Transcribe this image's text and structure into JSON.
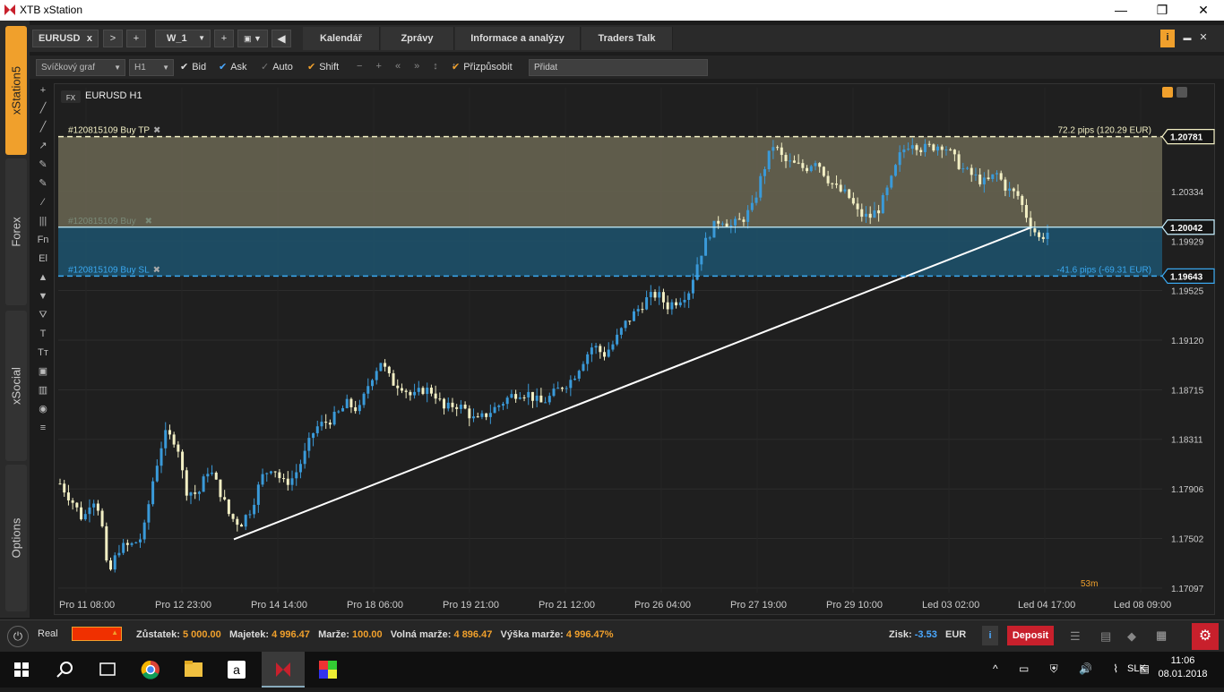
{
  "window": {
    "title": "XTB xStation",
    "min_label": "—",
    "max_label": "❐",
    "close_label": "✕"
  },
  "sidebar": {
    "tabs": [
      {
        "label": "xStation5"
      },
      {
        "label": "Forex"
      },
      {
        "label": "xSocial"
      },
      {
        "label": "Options"
      }
    ]
  },
  "tabbar": {
    "instrument_tab": "EURUSD",
    "close_x": "x",
    "next": ">",
    "add": "+",
    "workspace": "W_1",
    "workspace_add": "+",
    "nav": [
      "Kalendář",
      "Zprávy",
      "Informace a analýzy",
      "Traders Talk"
    ],
    "info_icon": "i",
    "minimize": "▬",
    "close": "✕"
  },
  "toolbar": {
    "chart_type": "Svíčkový graf",
    "interval": "H1",
    "bid": "Bid",
    "ask": "Ask",
    "auto": "Auto",
    "shift": "Shift",
    "fit": "Přizpůsobit",
    "add_placeholder": "Přidat"
  },
  "drawtools": [
    "+",
    "╱",
    "╱",
    "↗",
    "✎",
    "✎",
    "⁄",
    "|||",
    "Fn",
    "El",
    "▲",
    "▼",
    "⛛",
    "T",
    "Tт",
    "▣",
    "▥",
    "◉",
    "≡"
  ],
  "chart": {
    "badge": "FX",
    "title": "EURUSD H1",
    "tp_label": "#120815109 Buy  TP",
    "entry_label": "#120815109 Buy",
    "sl_label": "#120815109 Buy  SL",
    "tp_pips": "72.2 pips (120.29 EUR)",
    "sl_pips": "-41.6 pips (-69.31 EUR)",
    "timer": "53m",
    "colors": {
      "tp_zone": "#6b6754",
      "sl_zone": "#1d4e66",
      "bull": "#3a9ad9",
      "bear": "#f2efc4",
      "trend": "#ffffff"
    }
  },
  "chart_data": {
    "type": "candlestick",
    "symbol": "EURUSD",
    "interval": "H1",
    "y_ticks": [
      "1.17097",
      "1.17502",
      "1.17906",
      "1.18311",
      "1.18715",
      "1.19120",
      "1.19525",
      "1.19929",
      "1.20334"
    ],
    "y_tick_values": [
      1.17097,
      1.17502,
      1.17906,
      1.18311,
      1.18715,
      1.1912,
      1.19525,
      1.19929,
      1.20334
    ],
    "x_ticks": [
      "Pro 11 08:00",
      "Pro 12 23:00",
      "Pro 14 14:00",
      "Pro 18 06:00",
      "Pro 19 21:00",
      "Pro 21 12:00",
      "Pro 26 04:00",
      "Pro 27 19:00",
      "Pro 29 10:00",
      "Led 03 02:00",
      "Led 04 17:00",
      "Led 08 09:00"
    ],
    "ylim": [
      1.1706,
      1.2118
    ],
    "price_tags": [
      {
        "label": "1.20781",
        "value": 1.20781,
        "kind": "tp"
      },
      {
        "label": "1.20042",
        "value": 1.20042,
        "kind": "entry"
      },
      {
        "label": "1.19643",
        "value": 1.19643,
        "kind": "sl"
      }
    ],
    "close_path": [
      [
        0,
        1.1795
      ],
      [
        12,
        1.178
      ],
      [
        22,
        1.1765
      ],
      [
        30,
        1.1785
      ],
      [
        38,
        1.1772
      ],
      [
        45,
        1.1718
      ],
      [
        55,
        1.1742
      ],
      [
        68,
        1.1745
      ],
      [
        78,
        1.1752
      ],
      [
        88,
        1.18
      ],
      [
        98,
        1.1835
      ],
      [
        110,
        1.183
      ],
      [
        118,
        1.179
      ],
      [
        130,
        1.1786
      ],
      [
        140,
        1.1808
      ],
      [
        150,
        1.179
      ],
      [
        160,
        1.1768
      ],
      [
        170,
        1.1762
      ],
      [
        180,
        1.1775
      ],
      [
        190,
        1.18
      ],
      [
        200,
        1.181
      ],
      [
        210,
        1.1795
      ],
      [
        220,
        1.18
      ],
      [
        230,
        1.1818
      ],
      [
        240,
        1.184
      ],
      [
        250,
        1.1845
      ],
      [
        260,
        1.185
      ],
      [
        270,
        1.186
      ],
      [
        282,
        1.1855
      ],
      [
        292,
        1.188
      ],
      [
        302,
        1.1895
      ],
      [
        312,
        1.1878
      ],
      [
        322,
        1.1875
      ],
      [
        332,
        1.1865
      ],
      [
        342,
        1.1872
      ],
      [
        352,
        1.187
      ],
      [
        362,
        1.1855
      ],
      [
        372,
        1.186
      ],
      [
        382,
        1.1855
      ],
      [
        392,
        1.1845
      ],
      [
        402,
        1.1852
      ],
      [
        412,
        1.1858
      ],
      [
        422,
        1.1865
      ],
      [
        432,
        1.187
      ],
      [
        442,
        1.1868
      ],
      [
        452,
        1.186
      ],
      [
        462,
        1.1866
      ],
      [
        472,
        1.1874
      ],
      [
        482,
        1.188
      ],
      [
        492,
        1.1895
      ],
      [
        502,
        1.1908
      ],
      [
        512,
        1.19
      ],
      [
        522,
        1.191
      ],
      [
        532,
        1.1925
      ],
      [
        542,
        1.1935
      ],
      [
        552,
        1.1945
      ],
      [
        562,
        1.195
      ],
      [
        572,
        1.194
      ],
      [
        582,
        1.1945
      ],
      [
        592,
        1.1952
      ],
      [
        602,
        1.198
      ],
      [
        612,
        1.2
      ],
      [
        622,
        1.2012
      ],
      [
        632,
        1.2005
      ],
      [
        642,
        1.201
      ],
      [
        652,
        1.202
      ],
      [
        662,
        1.205
      ],
      [
        672,
        1.2072
      ],
      [
        682,
        1.2058
      ],
      [
        692,
        1.2055
      ],
      [
        702,
        1.2052
      ],
      [
        712,
        1.206
      ],
      [
        722,
        1.2045
      ],
      [
        732,
        1.2035
      ],
      [
        742,
        1.203
      ],
      [
        752,
        1.2015
      ],
      [
        762,
        1.2012
      ],
      [
        772,
        1.202
      ],
      [
        782,
        1.204
      ],
      [
        792,
        1.2065
      ],
      [
        802,
        1.2075
      ],
      [
        812,
        1.2068
      ],
      [
        822,
        1.207
      ],
      [
        832,
        1.2072
      ],
      [
        842,
        1.206
      ],
      [
        852,
        1.205
      ],
      [
        862,
        1.2045
      ],
      [
        872,
        1.204
      ],
      [
        882,
        1.2048
      ],
      [
        892,
        1.2035
      ],
      [
        902,
        1.203
      ],
      [
        912,
        1.201
      ],
      [
        922,
        1.1995
      ],
      [
        930,
        1.2
      ]
    ],
    "trendline": [
      [
        1.17495,
        260
      ],
      [
        1.20041,
        1150
      ]
    ]
  },
  "bottombar": {
    "account_type": "Real",
    "balance_label": "Zůstatek:",
    "balance": "5 000.00",
    "equity_label": "Majetek:",
    "equity": "4 996.47",
    "margin_label": "Marže:",
    "margin": "100.00",
    "free_margin_label": "Volná marže:",
    "free_margin": "4 896.47",
    "margin_level_label": "Výška marže:",
    "margin_level": "4 996.47%",
    "profit_label": "Zisk:",
    "profit": "-3.53",
    "currency": "EUR",
    "deposit": "Deposit",
    "colors": {
      "value": "#f0a02c",
      "profit": "#4aa8ff",
      "deposit": "#c8202c"
    }
  },
  "taskbar": {
    "time": "11:06",
    "date": "08.01.2018",
    "lang": "SLK"
  }
}
